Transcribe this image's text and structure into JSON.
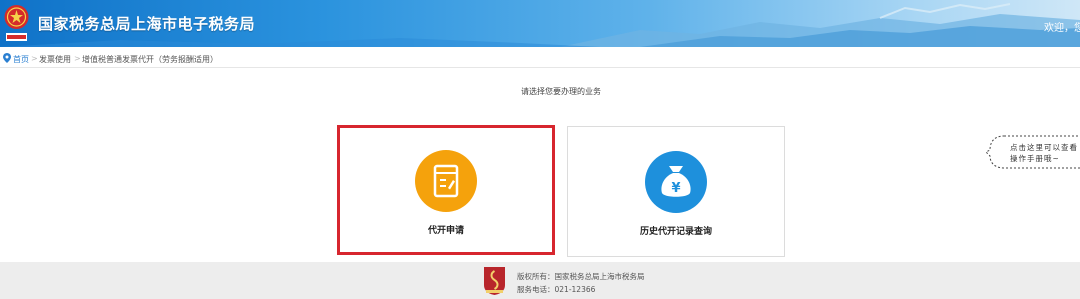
{
  "header": {
    "title": "国家税务总局上海市电子税务局",
    "welcome": "欢迎，您"
  },
  "breadcrumb": {
    "items": [
      "首页",
      "发票使用",
      "增值税普通发票代开（劳务报酬适用）"
    ],
    "separator": ">"
  },
  "main": {
    "prompt": "请选择您要办理的业务",
    "cards": [
      {
        "label": "代开申请",
        "icon": "invoice-icon",
        "selected": true
      },
      {
        "label": "历史代开记录查询",
        "icon": "money-bag-icon",
        "selected": false
      }
    ]
  },
  "help": {
    "line1": "点击这里可以查看",
    "line2": "操作手册哦~"
  },
  "footer": {
    "copyright": "版权所有：国家税务总局上海市税务局",
    "phone": "服务电话：021-12366"
  },
  "colors": {
    "accent_blue": "#1e90dc",
    "accent_orange": "#f5a20c",
    "selected_border": "#d7262e",
    "link": "#2a7fd1"
  }
}
